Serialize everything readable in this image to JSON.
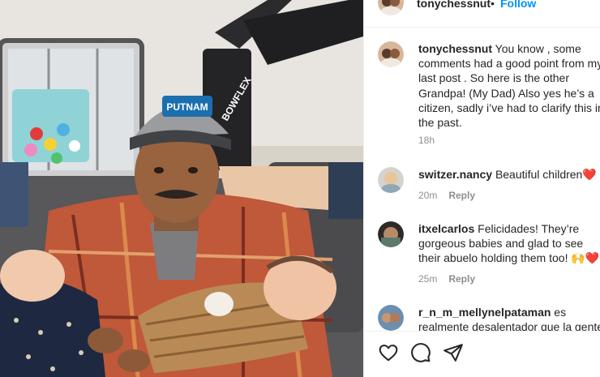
{
  "post": {
    "author": "tonychessnut",
    "follow_label": "Follow",
    "separator": "•"
  },
  "caption": {
    "user": "tonychessnut",
    "text": "You know , some comments had a good point from my last post . So here is the other Grandpa! (My Dad) Also yes he’s a citizen, sadly i’ve had to clarify this in the past.",
    "time": "18h"
  },
  "comments": [
    {
      "user": "switzer.nancy",
      "text": "Beautiful children",
      "emoji": "❤️",
      "time": "20m",
      "reply_label": "Reply"
    },
    {
      "user": "itxelcarlos",
      "text": "Felicidades! They’re gorgeous babies and glad to see their abuelo holding them too!",
      "emoji": "🙌❤️",
      "time": "25m",
      "reply_label": "Reply"
    },
    {
      "user": "r_n_m_mellynelpataman",
      "text": "es realmente desalentador que la gente",
      "emoji": "",
      "time": "",
      "reply_label": ""
    }
  ],
  "photo": {
    "cap_text": "PUTNAM",
    "machine_text": "BOWFLEX"
  },
  "actions": {
    "icons": [
      "heart-icon",
      "comment-icon",
      "share-icon"
    ]
  }
}
